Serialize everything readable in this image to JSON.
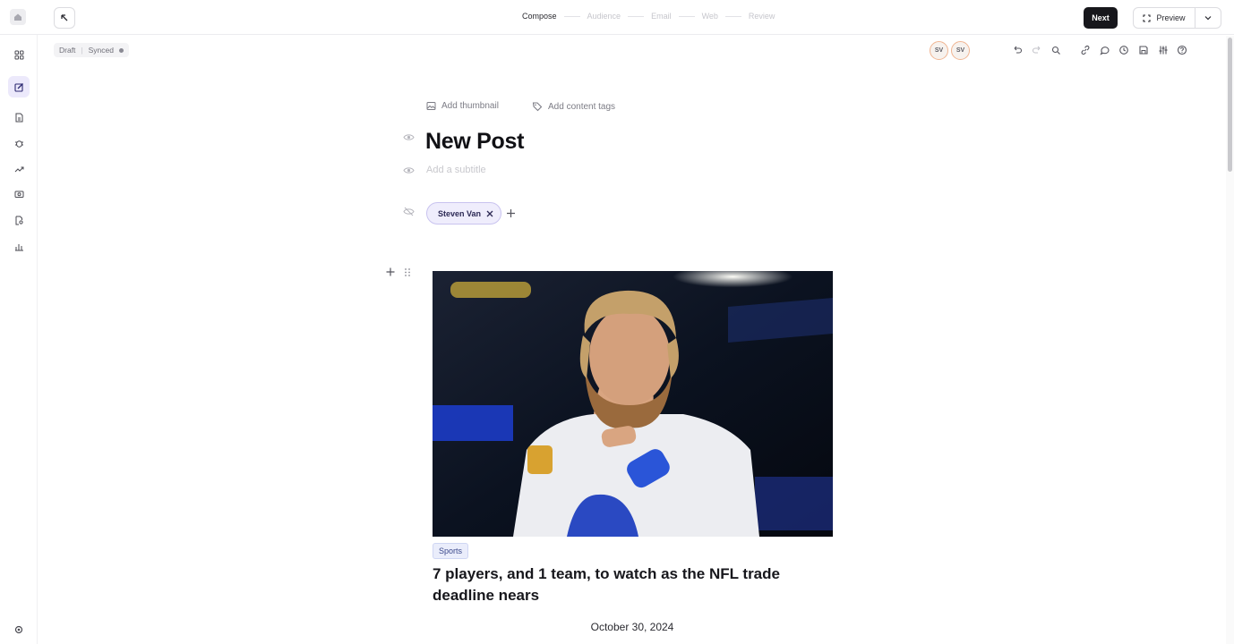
{
  "header": {
    "steps": [
      {
        "label": "Compose",
        "active": true
      },
      {
        "label": "Audience",
        "active": false
      },
      {
        "label": "Email",
        "active": false
      },
      {
        "label": "Web",
        "active": false
      },
      {
        "label": "Review",
        "active": false
      }
    ],
    "next_label": "Next",
    "preview_label": "Preview"
  },
  "sidebar": {
    "items": [
      {
        "icon": "grid-icon",
        "active": false
      },
      {
        "icon": "edit-icon",
        "active": true
      },
      {
        "icon": "document-icon",
        "active": false
      },
      {
        "icon": "bug-icon",
        "active": false
      },
      {
        "icon": "trending-icon",
        "active": false
      },
      {
        "icon": "dollar-card-icon",
        "active": false
      },
      {
        "icon": "file-search-icon",
        "active": false
      },
      {
        "icon": "bar-chart-icon",
        "active": false
      }
    ],
    "settings_icon": "gear-icon"
  },
  "status": {
    "state": "Draft",
    "sync": "Synced"
  },
  "collaborators": [
    "SV",
    "SV"
  ],
  "toolbar": {
    "icons": [
      "undo-icon",
      "redo-icon",
      "search-icon",
      "link-icon",
      "comment-icon",
      "history-icon",
      "save-icon",
      "settings-sliders-icon",
      "help-icon"
    ]
  },
  "editor": {
    "add_thumbnail": "Add thumbnail",
    "add_tags": "Add content tags",
    "title": "New Post",
    "subtitle_placeholder": "Add a subtitle",
    "author": "Steven Van",
    "article": {
      "tag": "Sports",
      "headline": "7 players, and 1 team, to watch as the NFL trade deadline nears",
      "date": "October 30, 2024"
    }
  },
  "colors": {
    "accent": "#ece9fb",
    "primary_button": "#17171c",
    "chip_border": "#c9c3ef"
  }
}
